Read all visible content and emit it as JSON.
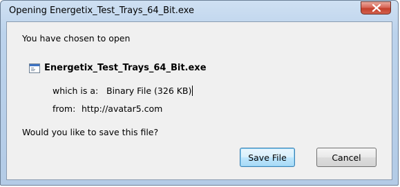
{
  "window": {
    "title": "Opening Energetix_Test_Trays_64_Bit.exe"
  },
  "dialog": {
    "intro": "You have chosen to open",
    "file_name": "Energetix_Test_Trays_64_Bit.exe",
    "type_label": "which is a:",
    "type_value": "Binary File (326  KB)",
    "from_label": "from:",
    "from_value": "http://avatar5.com",
    "question": "Would you like to save this file?"
  },
  "buttons": {
    "save": "Save File",
    "cancel": "Cancel"
  },
  "icons": {
    "close": "close-icon",
    "file": "executable-file-icon"
  },
  "colors": {
    "frame": "#bcd3ec",
    "close_button": "#c4402c",
    "default_button": "#bee6fd"
  }
}
